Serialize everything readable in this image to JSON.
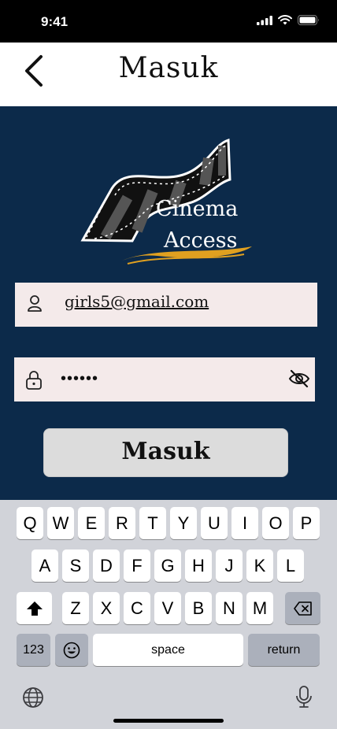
{
  "status_bar": {
    "time": "9:41"
  },
  "header": {
    "title": "Masuk"
  },
  "logo": {
    "line1": "Cinema",
    "line2": "Access"
  },
  "form": {
    "email_value": "girls5@gmail.com",
    "password_value": "••••••",
    "submit_label": "Masuk"
  },
  "keyboard": {
    "row1": [
      "Q",
      "W",
      "E",
      "R",
      "T",
      "Y",
      "U",
      "I",
      "O",
      "P"
    ],
    "row2": [
      "A",
      "S",
      "D",
      "F",
      "G",
      "H",
      "J",
      "K",
      "L"
    ],
    "row3": [
      "Z",
      "X",
      "C",
      "V",
      "B",
      "N",
      "M"
    ],
    "numbers_label": "123",
    "space_label": "space",
    "return_label": "return"
  },
  "colors": {
    "background": "#0c2a4a",
    "field": "#f4eaea",
    "button": "#dcdcdc",
    "logo_swoosh": "#e0a020"
  }
}
